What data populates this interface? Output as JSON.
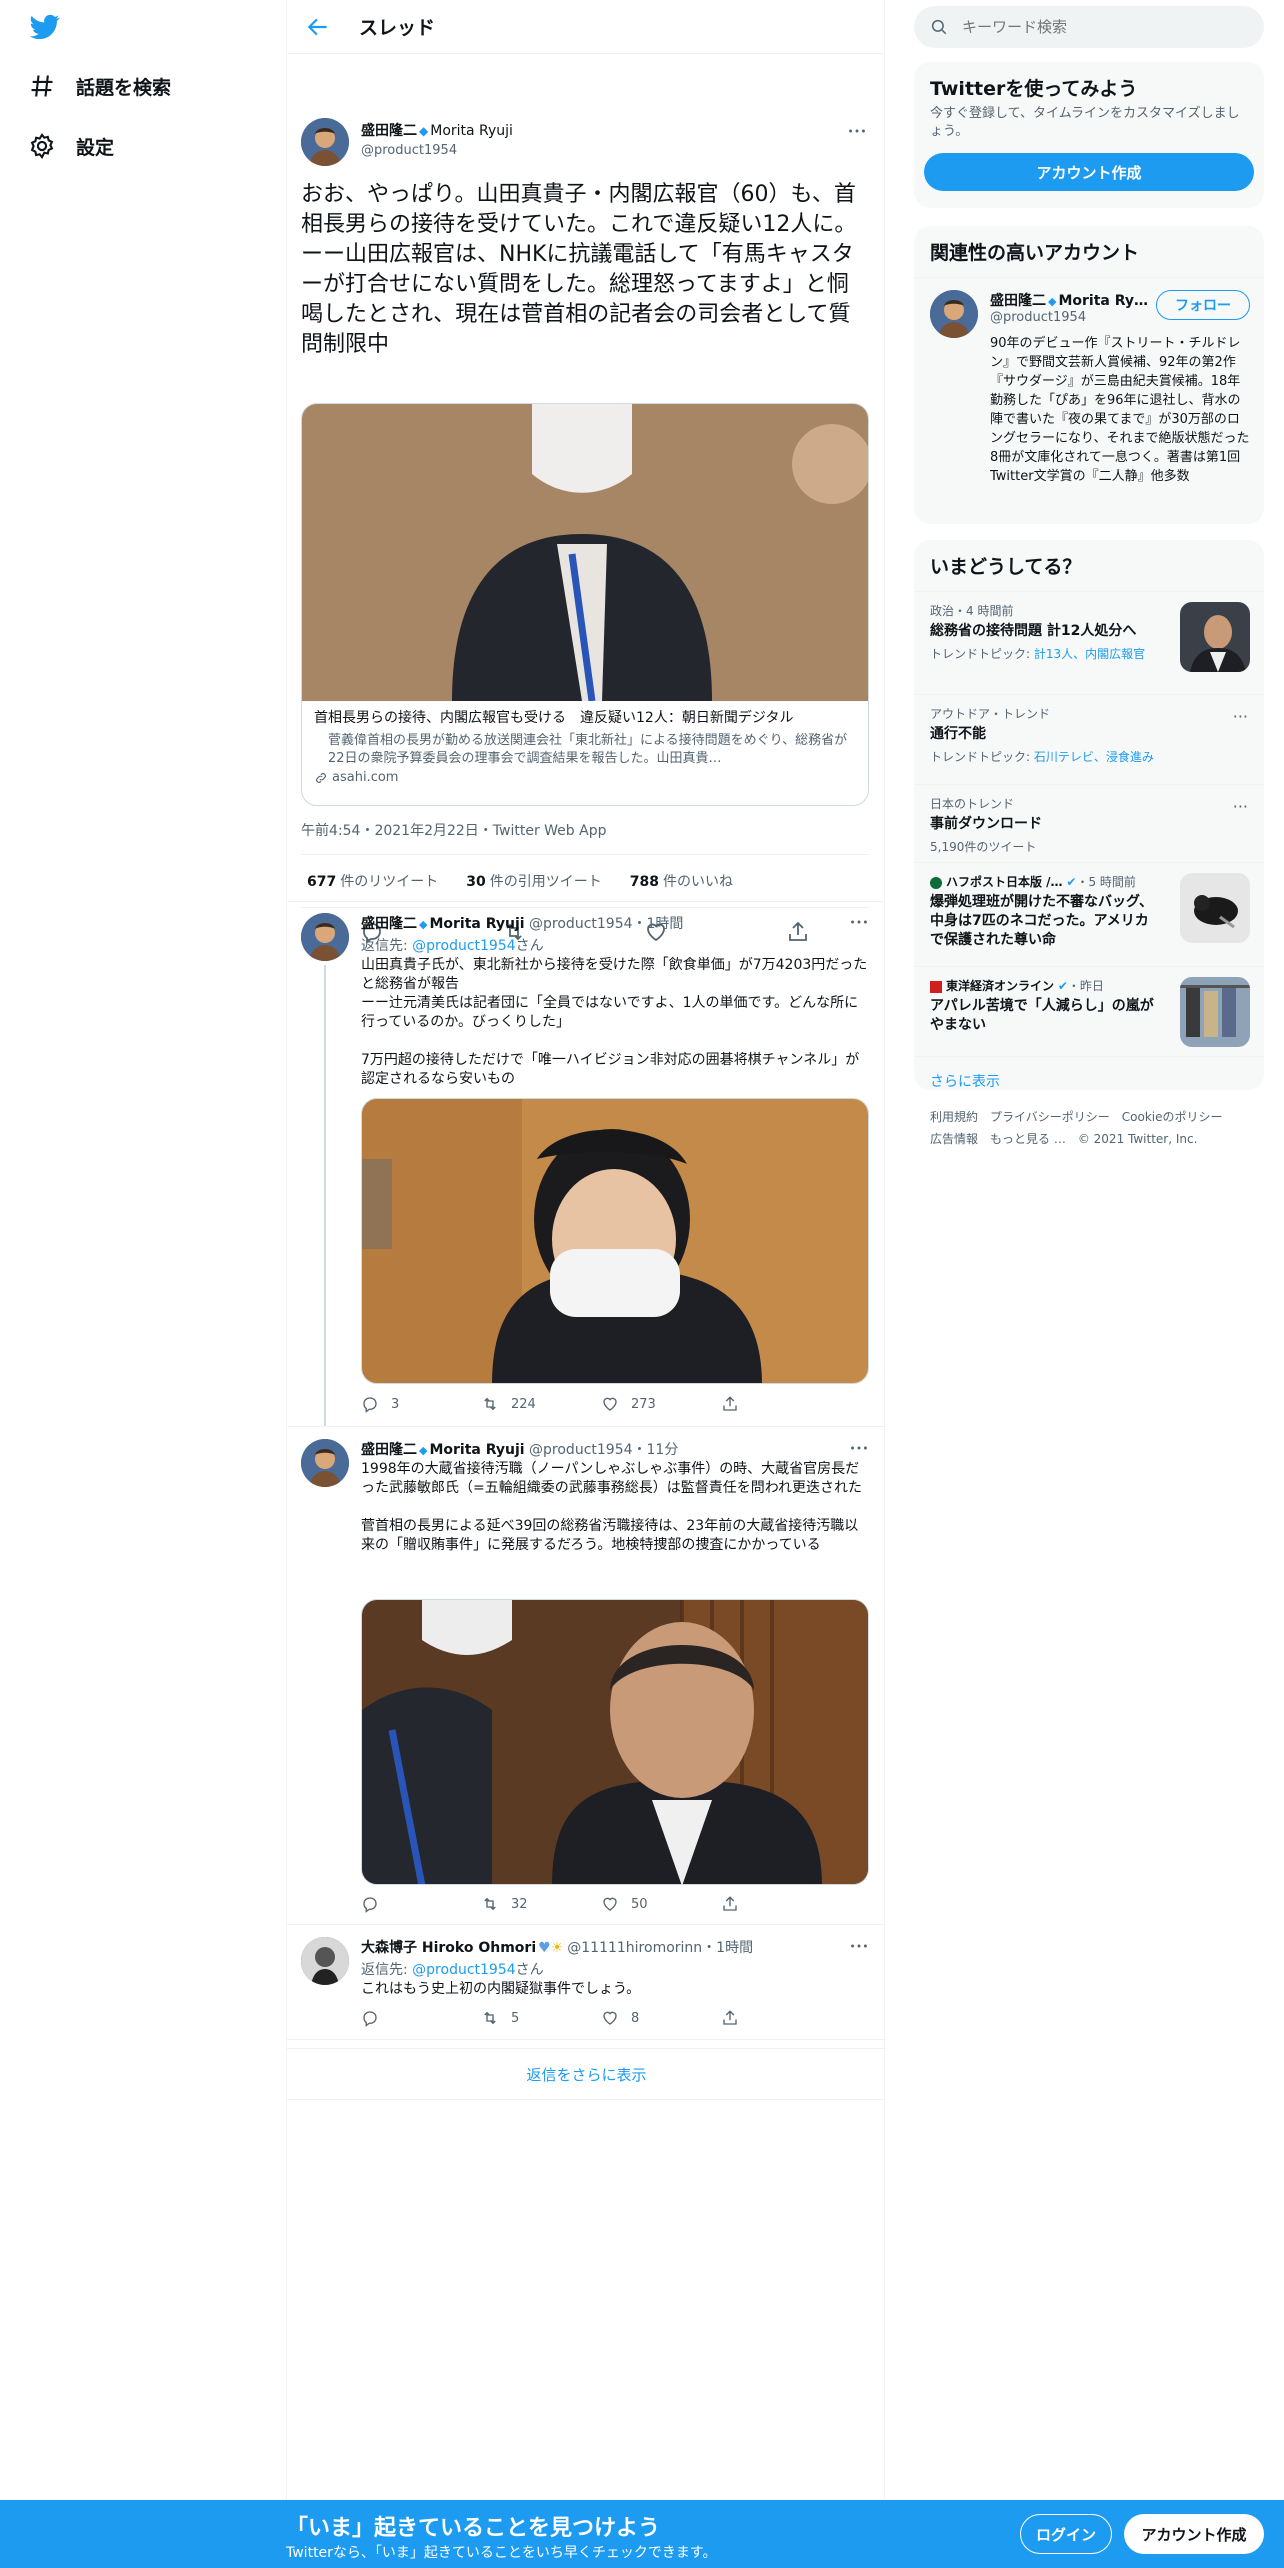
{
  "nav": {
    "explore_label": "話題を検索",
    "settings_label": "設定"
  },
  "main": {
    "header_title": "スレッド",
    "tweet": {
      "name": "盛田隆二",
      "name_suffix": "Morita Ryuji",
      "handle": "@product1954",
      "text": "おお、やっぱり。山田真貴子・内閣広報官（60）も、首相長男らの接待を受けていた。これで違反疑い12人に。\nーー山田広報官は、NHKに抗議電話して「有馬キャスターが打合せにない質問をした。総理怒ってますよ」と恫喝したとされ、現在は菅首相の記者会の司会者として質問制限中",
      "card_title": "首相長男らの接待、内閣広報官も受ける　違反疑い12人：朝日新聞デジタル",
      "card_desc": "菅義偉首相の長男が勤める放送関連会社「東北新社」による接待問題をめぐり、総務省が22日の衆院予算委員会の理事会で調査結果を報告した。山田真貴…",
      "card_domain": "asahi.com",
      "meta": "午前4:54・2021年2月22日・Twitter Web App",
      "retweets_count": "677",
      "retweets_label": "件のリツイート",
      "quotes_count": "30",
      "quotes_label": "件の引用ツイート",
      "likes_count": "788",
      "likes_label": "件のいいね"
    },
    "replies": [
      {
        "name": "盛田隆二",
        "name_suffix": "Morita Ryuji",
        "handle_time": "@product1954・1時間",
        "reply_to_prefix": "返信先:",
        "reply_to_handle": "@product1954",
        "reply_to_suffix": "さん",
        "text": "山田真貴子氏が、東北新社から接待を受けた際「飲食単価」が7万4203円だったと総務省が報告\nーー辻元清美氏は記者団に「全員ではないですよ、1人の単価です。どんな所に行っているのか。びっくりした」\n\n7万円超の接待しただけで「唯一ハイビジョン非対応の囲碁将棋チャンネル」が認定されるなら安いもの",
        "replies": "3",
        "retweets": "224",
        "likes": "273"
      },
      {
        "name": "盛田隆二",
        "name_suffix": "Morita Ryuji",
        "handle_time": "@product1954・11分",
        "text": "1998年の大蔵省接待汚職（ノーパンしゃぶしゃぶ事件）の時、大蔵省官房長だった武藤敏郎氏（=五輪組織委の武藤事務総長）は監督責任を問われ更迭された\n\n菅首相の長男による延べ39回の総務省汚職接待は、23年前の大蔵省接待汚職以来の「贈収賄事件」に発展するだろう。地検特捜部の捜査にかかっている",
        "replies": "",
        "retweets": "32",
        "likes": "50"
      },
      {
        "name": "大森博子 Hiroko Ohmori",
        "handle_time": "@11111hiromorinn・1時間",
        "reply_to_prefix": "返信先:",
        "reply_to_handle": "@product1954",
        "reply_to_suffix": "さん",
        "text": "これはもう史上初の内閣疑獄事件でしょう。",
        "replies": "",
        "retweets": "5",
        "likes": "8"
      }
    ],
    "show_more": "返信をさらに表示"
  },
  "sidebar": {
    "search_placeholder": "キーワード検索",
    "signup": {
      "title": "Twitterを使ってみよう",
      "desc": "今すぐ登録して、タイムラインをカスタマイズしましょう。",
      "button": "アカウント作成"
    },
    "relevant": {
      "title": "関連性の高いアカウント",
      "name": "盛田隆二",
      "name_suffix": "Morita Ry…",
      "handle": "@product1954",
      "follow": "フォロー",
      "bio": "90年のデビュー作『ストリート・チルドレン』で野間文芸新人賞候補、92年の第2作『サウダージ』が三島由紀夫賞候補。18年勤務した「ぴあ」を96年に退社し、背水の陣で書いた『夜の果てまで』が30万部のロングセラーになり、それまで絶版状態だった8冊が文庫化されて一息つく。著書は第1回Twitter文学賞の『二人静』他多数"
    },
    "trends": {
      "title": "いまどうしてる？",
      "items": [
        {
          "category": "政治・4 時間前",
          "title": "総務省の接待問題 計12人処分へ",
          "sub_prefix": "トレンドトピック:",
          "sub_links": "計13人、内閣広報官"
        },
        {
          "category": "アウトドア・トレンド",
          "title": "通行不能",
          "sub_prefix": "トレンドトピック:",
          "sub_links": "石川テレビ、浸食進み"
        },
        {
          "category": "日本のトレンド",
          "title": "事前ダウンロード",
          "sub_plain": "5,190件のツイート"
        },
        {
          "category_source": "ハフポスト日本版 /…",
          "category_time": "・5 時間前",
          "title": "爆弾処理班が開けた不審なバッグ、中身は7匹のネコだった。アメリカで保護された尊い命"
        },
        {
          "category_source": "東洋経済オンライン",
          "category_time": "・昨日",
          "title": "アパレル苦境で「人減らし」の嵐がやまない"
        }
      ],
      "show_more": "さらに表示"
    },
    "footer": [
      "利用規約",
      "プライバシーポリシー",
      "Cookieのポリシー",
      "広告情報",
      "もっと見る …",
      "© 2021 Twitter, Inc."
    ]
  },
  "bottom": {
    "title": "「いま」起きていることを見つけよう",
    "subtitle": "Twitterなら、「いま」起きていることをいち早くチェックできます。",
    "login": "ログイン",
    "signup": "アカウント作成"
  },
  "colors": {
    "accent": "#1d9bf0",
    "text": "#0f1419",
    "muted": "#536471",
    "border": "#eff3f4",
    "panel": "#f7f9f9"
  },
  "icons": [
    "twitter-logo-icon",
    "hashtag-icon",
    "gear-icon",
    "back-arrow-icon",
    "more-icon",
    "reply-icon",
    "retweet-icon",
    "like-icon",
    "share-icon",
    "search-icon",
    "link-icon",
    "verified-icon",
    "heart-emoji-icon",
    "sun-emoji-icon"
  ]
}
